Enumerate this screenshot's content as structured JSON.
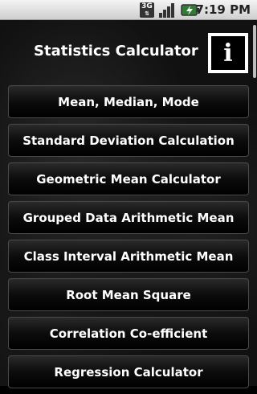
{
  "status_bar": {
    "network_label": "3G",
    "time": "7:19 PM"
  },
  "header": {
    "title": "Statistics Calculator",
    "info_button_glyph": "i"
  },
  "menu": {
    "items": [
      {
        "label": "Mean, Median, Mode"
      },
      {
        "label": "Standard Deviation Calculation"
      },
      {
        "label": "Geometric Mean Calculator"
      },
      {
        "label": "Grouped Data Arithmetic Mean"
      },
      {
        "label": "Class Interval Arithmetic Mean"
      },
      {
        "label": "Root Mean Square"
      },
      {
        "label": "Correlation Co-efficient"
      },
      {
        "label": "Regression Calculator"
      }
    ]
  },
  "colors": {
    "background": "#111111",
    "button_text": "#ffffff",
    "status_bar": "#e0e0e0"
  }
}
